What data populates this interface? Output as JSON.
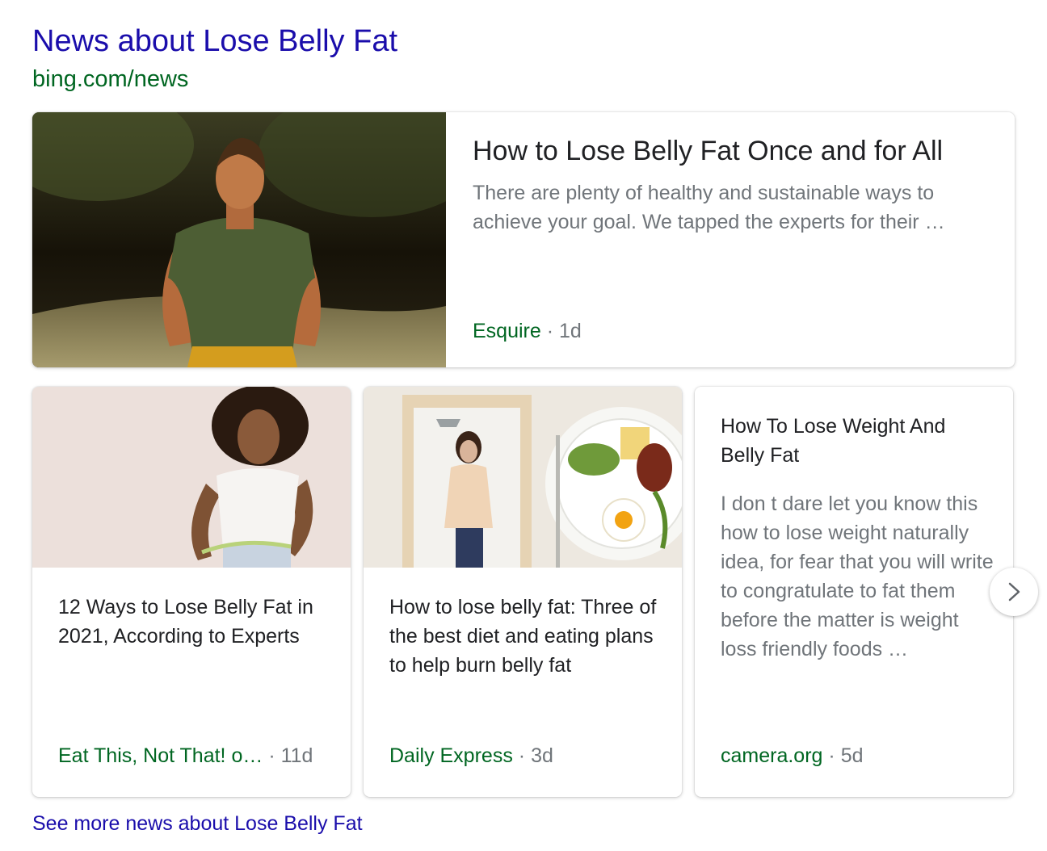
{
  "header": {
    "title": "News about Lose Belly Fat",
    "source_url": "bing.com/news"
  },
  "featured": {
    "headline": "How to Lose Belly Fat Once and for All",
    "snippet": "There are plenty of healthy and sustainable ways to achieve your goal. We tapped the experts for their …",
    "source": "Esquire",
    "separator": "·",
    "age": "1d",
    "image": "man-running-outdoors-photo"
  },
  "cards": [
    {
      "headline": "12 Ways to Lose Belly Fat in 2021, According to Experts",
      "source": "Eat This, Not That! o…",
      "separator": "·",
      "age": "11d",
      "image": "woman-measuring-waist-photo"
    },
    {
      "headline": "How to lose belly fat: Three of the best diet and eating plans to help burn belly fat",
      "source": "Daily Express",
      "separator": "·",
      "age": "3d",
      "image": "woman-mirror-and-healthy-plate-photo"
    },
    {
      "headline": "How To Lose Weight And Belly Fat",
      "snippet": "I don t dare let you know this how to lose weight naturally idea, for fear that you will write to congratulate to fat them before the matter is weight loss friendly foods …",
      "source": "camera.org",
      "separator": "·",
      "age": "5d"
    }
  ],
  "navigation": {
    "next_icon": "chevron-right-icon"
  },
  "footer": {
    "see_more": "See more news about Lose Belly Fat"
  },
  "colors": {
    "link": "#1a0dab",
    "source_green": "#006621",
    "muted": "#70757a",
    "text": "#202124"
  }
}
